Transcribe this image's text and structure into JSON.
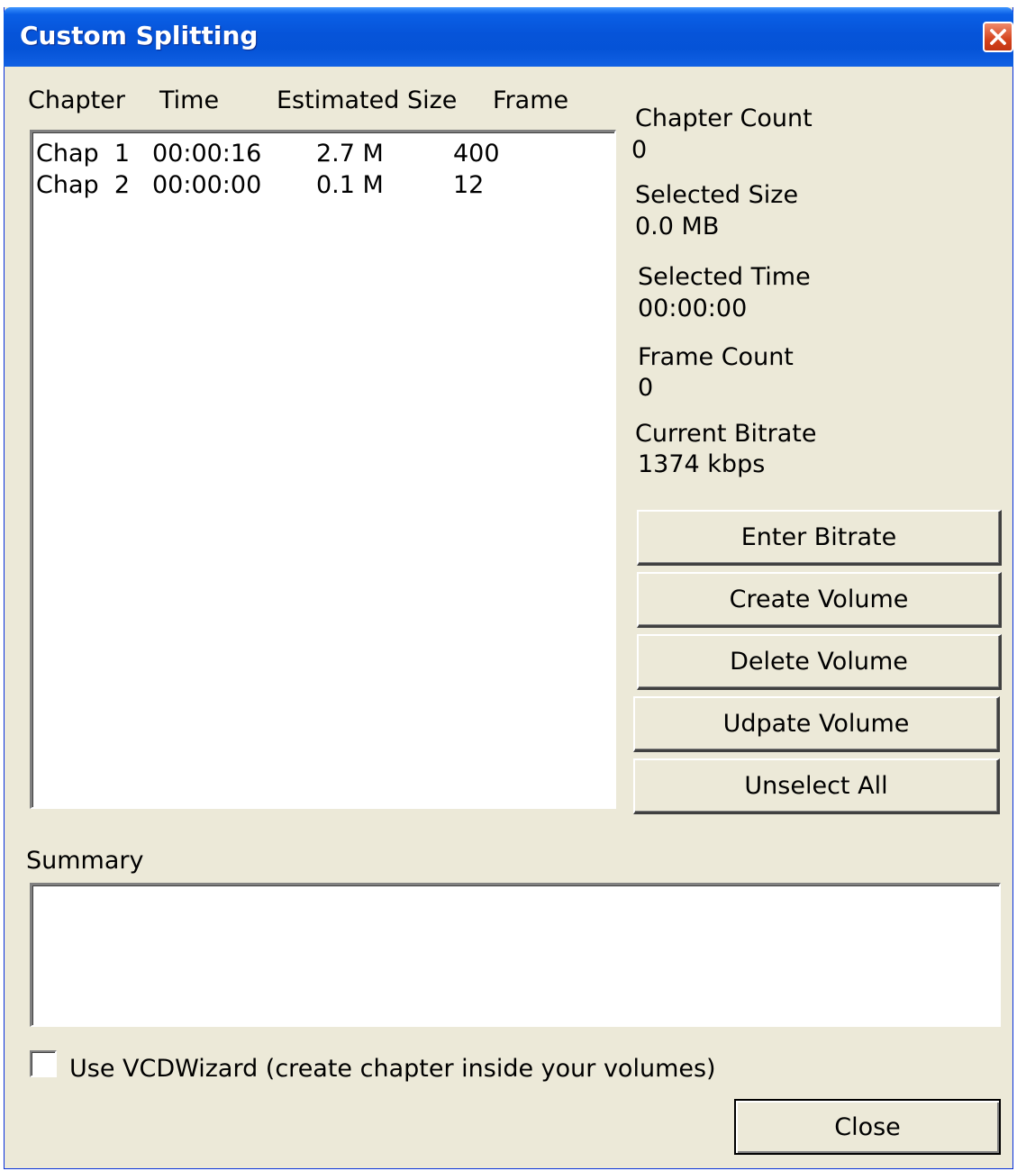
{
  "window": {
    "title": "Custom Splitting",
    "colors": {
      "titlebar": "#0654d9",
      "body": "#ece9d8",
      "close": "#d4431d"
    }
  },
  "list": {
    "columns": [
      "Chapter",
      "Time",
      "Estimated Size",
      "Frame"
    ],
    "rows": [
      {
        "chapter": "Chap  1",
        "time": "00:00:16",
        "size": "2.7 M",
        "frame": "400"
      },
      {
        "chapter": "Chap  2",
        "time": "00:00:00",
        "size": "0.1 M",
        "frame": "12"
      }
    ]
  },
  "stats": {
    "chapter_count_label": "Chapter Count",
    "chapter_count": "0",
    "selected_size_label": "Selected Size",
    "selected_size": "0.0 MB",
    "selected_time_label": "Selected Time",
    "selected_time": "00:00:00",
    "frame_count_label": "Frame Count",
    "frame_count": "0",
    "current_bitrate_label": "Current Bitrate",
    "current_bitrate": "1374 kbps"
  },
  "buttons": {
    "enter_bitrate": "Enter Bitrate",
    "create_volume": "Create Volume",
    "delete_volume": "Delete Volume",
    "update_volume": "Udpate Volume",
    "unselect_all": "Unselect All",
    "close": "Close"
  },
  "summary": {
    "label": "Summary",
    "value": ""
  },
  "vcdwizard": {
    "label": "Use VCDWizard (create chapter inside your volumes)",
    "checked": false
  },
  "icons": {
    "close": "close-icon",
    "checkbox": "checkbox-icon"
  }
}
